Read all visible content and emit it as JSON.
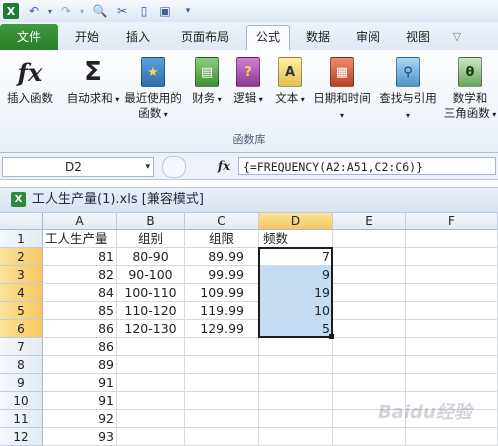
{
  "qat": {
    "icons": [
      "excel-logo-icon",
      "undo-icon",
      "redo-icon",
      "print-preview-icon",
      "tools-icon",
      "new-file-icon",
      "save-icon",
      "customize-icon"
    ]
  },
  "tabs": [
    "文件",
    "开始",
    "插入",
    "页面布局",
    "公式",
    "数据",
    "审阅",
    "视图"
  ],
  "active_tab": "公式",
  "ribbon": {
    "buttons": [
      {
        "l1": "插入函数",
        "l2": ""
      },
      {
        "l1": "自动求和",
        "l2": ""
      },
      {
        "l1": "最近使用的",
        "l2": "函数"
      },
      {
        "l1": "财务",
        "l2": ""
      },
      {
        "l1": "逻辑",
        "l2": ""
      },
      {
        "l1": "文本",
        "l2": ""
      },
      {
        "l1": "日期和时间",
        "l2": ""
      },
      {
        "l1": "查找与引用",
        "l2": ""
      },
      {
        "l1": "数学和",
        "l2": "三角函数"
      }
    ],
    "group_label": "函数库"
  },
  "formula_bar": {
    "name_box": "D2",
    "fx": "fx",
    "formula": "{=FREQUENCY(A2:A51,C2:C6)}"
  },
  "workbook": {
    "title": "工人生产量(1).xls  [兼容模式]"
  },
  "columns": [
    "A",
    "B",
    "C",
    "D",
    "E",
    "F"
  ],
  "rows": [
    [
      "工人生产量",
      "组别",
      "组限",
      "频数",
      "",
      ""
    ],
    [
      "81",
      "80-90",
      "89.99",
      "7",
      "",
      ""
    ],
    [
      "82",
      "90-100",
      "99.99",
      "9",
      "",
      ""
    ],
    [
      "84",
      "100-110",
      "109.99",
      "19",
      "",
      ""
    ],
    [
      "85",
      "110-120",
      "119.99",
      "10",
      "",
      ""
    ],
    [
      "86",
      "120-130",
      "129.99",
      "5",
      "",
      ""
    ],
    [
      "86",
      "",
      "",
      "",
      "",
      ""
    ],
    [
      "89",
      "",
      "",
      "",
      "",
      ""
    ],
    [
      "91",
      "",
      "",
      "",
      "",
      ""
    ],
    [
      "91",
      "",
      "",
      "",
      "",
      ""
    ],
    [
      "92",
      "",
      "",
      "",
      "",
      ""
    ],
    [
      "93",
      "",
      "",
      "",
      "",
      ""
    ]
  ],
  "row_numbers": [
    "1",
    "2",
    "3",
    "4",
    "5",
    "6",
    "7",
    "8",
    "9",
    "10",
    "11",
    "12"
  ],
  "watermark": "Baidu经验"
}
